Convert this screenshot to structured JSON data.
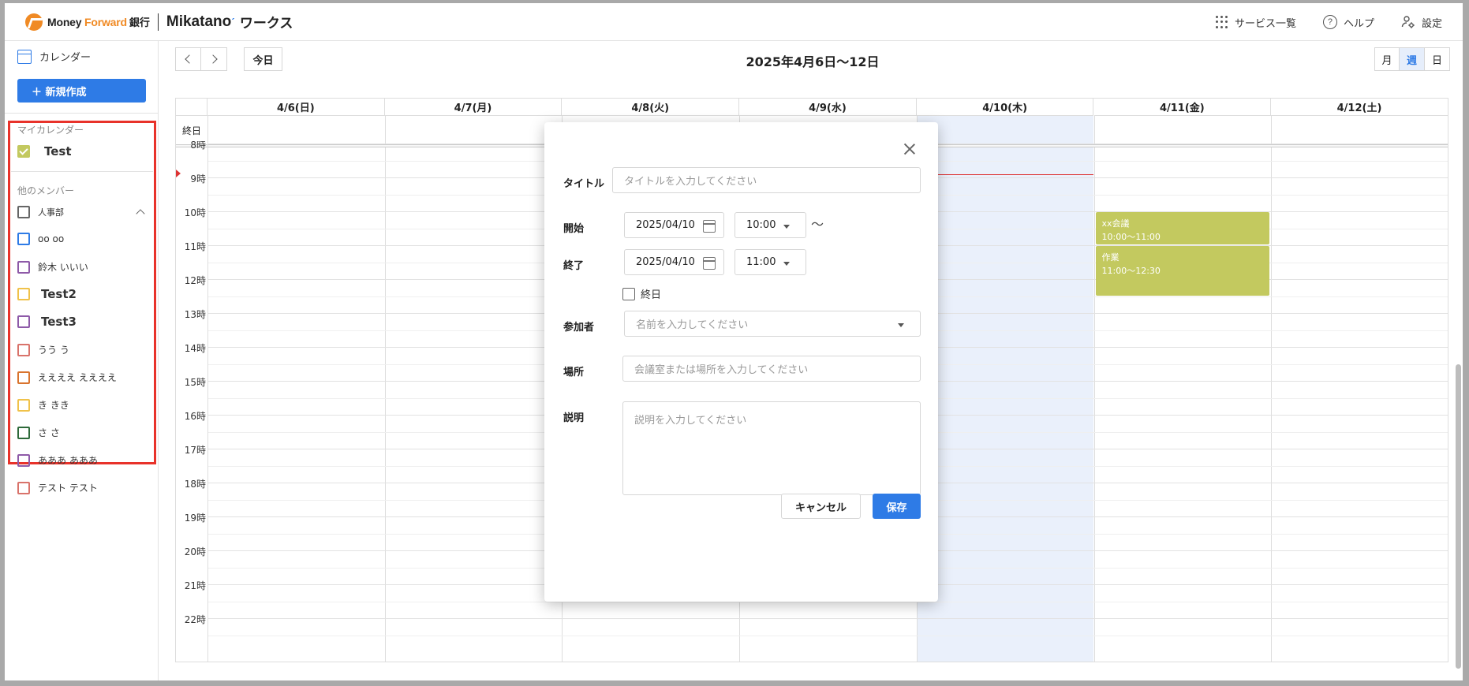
{
  "header": {
    "logo_moneyforward_1": "Money ",
    "logo_moneyforward_2": "Forward",
    "logo_bank": "銀行",
    "logo_mikatano": "Mikatano",
    "logo_works": "ワークス",
    "services_label": "サービス一覧",
    "help_label": "ヘルプ",
    "settings_label": "設定"
  },
  "sidebar": {
    "calendar_label": "カレンダー",
    "new_button": "＋  新規作成",
    "my_calendar_label": "マイカレンダー",
    "my_calendars": [
      {
        "name": "Test",
        "color": "#c3c95f",
        "checked": true
      }
    ],
    "other_members_label": "他のメンバー",
    "members": [
      {
        "name": "人事部",
        "color": "#666666"
      },
      {
        "name": "oo oo",
        "color": "#2e7be6"
      },
      {
        "name": "鈴木 いいい",
        "color": "#8e5aa8"
      },
      {
        "name": "Test2",
        "color": "#f0c24a"
      },
      {
        "name": "Test3",
        "color": "#8e5aa8"
      },
      {
        "name": "うう う",
        "color": "#d9736b"
      },
      {
        "name": "ええええ ええええ",
        "color": "#d9742e"
      },
      {
        "name": "き きき",
        "color": "#f0c24a"
      },
      {
        "name": "さ さ",
        "color": "#2e6a3a"
      },
      {
        "name": "あああ あああ",
        "color": "#8e5aa8"
      },
      {
        "name": "テスト テスト",
        "color": "#d9736b"
      }
    ]
  },
  "toolbar": {
    "today_label": "今日",
    "range_title": "2025年4月6日〜12日",
    "views": [
      "月",
      "週",
      "日"
    ],
    "active_view": "週"
  },
  "calendar": {
    "days": [
      "4/6(日)",
      "4/7(月)",
      "4/8(火)",
      "4/9(水)",
      "4/10(木)",
      "4/11(金)",
      "4/12(土)"
    ],
    "highlight_day": "4/10(木)",
    "allday_label": "終日",
    "hours": [
      "8時",
      "9時",
      "10時",
      "11時",
      "12時",
      "13時",
      "14時",
      "15時",
      "16時",
      "17時",
      "18時",
      "19時",
      "20時",
      "21時",
      "22時"
    ],
    "events": [
      {
        "title": "xx会議",
        "time": "10:00〜11:00",
        "day": "4/11(金)",
        "color": "#c3c95f"
      },
      {
        "title": "作業",
        "time": "11:00〜12:30",
        "day": "4/11(金)",
        "color": "#c3c95f"
      }
    ]
  },
  "modal": {
    "title_label": "タイトル",
    "title_placeholder": "タイトルを入力してください",
    "start_label": "開始",
    "start_date": "2025/04/10",
    "start_time": "10:00",
    "tilde": "〜",
    "end_label": "終了",
    "end_date": "2025/04/10",
    "end_time": "11:00",
    "allday_label": "終日",
    "attendees_label": "参加者",
    "attendees_placeholder": "名前を入力してください",
    "location_label": "場所",
    "location_placeholder": "会議室または場所を入力してください",
    "description_label": "説明",
    "description_placeholder": "説明を入力してください",
    "cancel_label": "キャンセル",
    "save_label": "保存"
  }
}
